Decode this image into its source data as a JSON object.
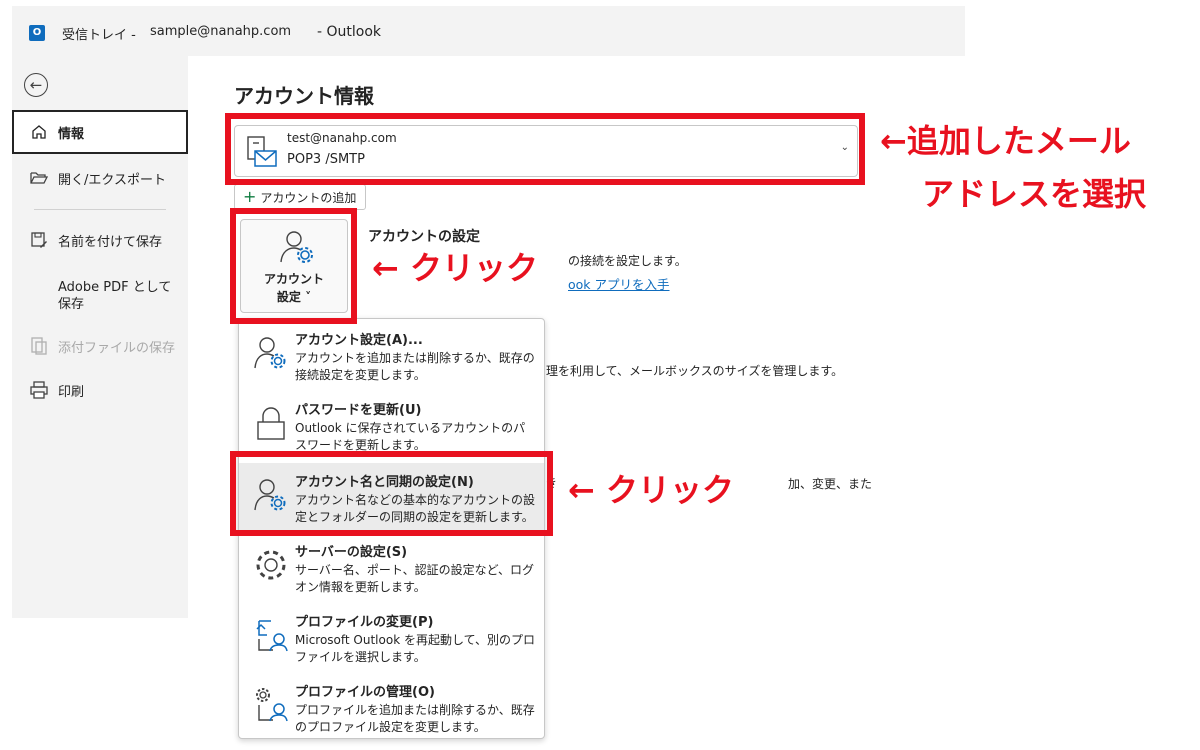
{
  "titlebar": {
    "folder": "受信トレイ -",
    "email": "sample@nanahp.com",
    "app": "- Outlook",
    "app_icon": "O"
  },
  "sidebar": {
    "back_icon": "arrow-left-circle-icon",
    "items": [
      {
        "label": "情報",
        "icon": "home-icon",
        "active": true
      },
      {
        "label": "開く/エクスポート",
        "icon": "folder-open-icon"
      },
      {
        "label": "名前を付けて保存",
        "icon": "save-as-icon"
      },
      {
        "label_line1": "Adobe PDF として",
        "label_line2": "保存"
      },
      {
        "label": "添付ファイルの保存",
        "icon": "attachment-save-icon",
        "disabled": true
      },
      {
        "label": "印刷",
        "icon": "printer-icon"
      }
    ]
  },
  "main": {
    "title": "アカウント情報",
    "account": {
      "email": "test@nanahp.com",
      "type": "POP3  /SMTP"
    },
    "add_account_label": "アカウントの追加",
    "settings_button": {
      "line1": "アカウント",
      "line2": "設定 ˅"
    },
    "section_title": "アカウントの設定",
    "section_desc": "の接続を設定します。",
    "section_link": "ook アプリを入手",
    "bg_text_1": "理を利用して、メールボックスのサイズを管理します。",
    "bg_text_2": "き",
    "bg_text_3": "加、変更、また"
  },
  "menu": {
    "items": [
      {
        "title": "アカウント設定(A)...",
        "desc": "アカウントを追加または削除するか、既存の接続設定を変更します。",
        "icon": "account-settings-icon"
      },
      {
        "title": "パスワードを更新(U)",
        "desc": "Outlook に保存されているアカウントのパスワードを更新します。",
        "icon": "lock-icon"
      },
      {
        "title": "アカウント名と同期の設定(N)",
        "desc": "アカウント名などの基本的なアカウントの設定とフォルダーの同期の設定を更新します。",
        "icon": "account-sync-icon"
      },
      {
        "title": "サーバーの設定(S)",
        "desc": "サーバー名、ポート、認証の設定など、ログオン情報を更新します。",
        "icon": "gear-icon"
      },
      {
        "title": "プロファイルの変更(P)",
        "desc": "Microsoft Outlook を再起動して、別のプロファイルを選択します。",
        "icon": "profile-change-icon"
      },
      {
        "title": "プロファイルの管理(O)",
        "desc": "プロファイルを追加または削除するか、既存のプロファイル設定を変更します。",
        "icon": "profile-manage-icon"
      }
    ]
  },
  "annotations": {
    "select_line1": "←追加したメール",
    "select_line2": "アドレスを選択",
    "click1": "← クリック",
    "click2": "← クリック",
    "color": "#e8111f"
  }
}
